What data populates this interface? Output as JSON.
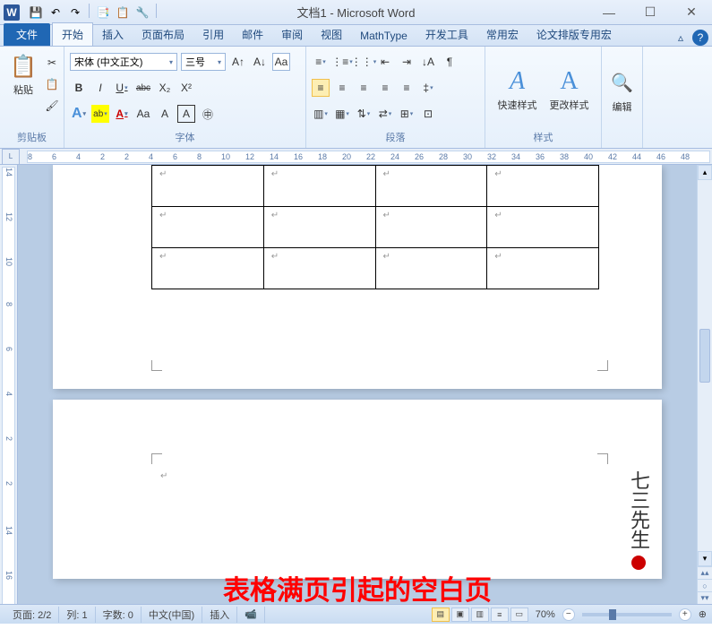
{
  "titlebar": {
    "app_icon": "W",
    "title": "文档1 - Microsoft Word"
  },
  "qat": [
    "💾",
    "↶",
    "↷",
    "📑",
    "📋",
    "🔧"
  ],
  "win": {
    "min": "—",
    "max": "☐",
    "close": "✕"
  },
  "tabs": {
    "file": "文件",
    "items": [
      "开始",
      "插入",
      "页面布局",
      "引用",
      "邮件",
      "审阅",
      "视图",
      "MathType",
      "开发工具",
      "常用宏",
      "论文排版专用宏"
    ],
    "active": 0,
    "minimize": "▵",
    "help": "?"
  },
  "ribbon": {
    "clipboard": {
      "label": "剪贴板",
      "paste": "粘贴",
      "cut": "✂",
      "copy": "📋",
      "painter": "🖌"
    },
    "font": {
      "label": "字体",
      "family": "宋体 (中文正文)",
      "size": "三号",
      "grow": "A↑",
      "shrink": "A↓",
      "clear": "Aa",
      "bold": "B",
      "italic": "I",
      "underline": "U",
      "strike": "abc",
      "sub": "X₂",
      "sup": "X²",
      "effects": "A",
      "highlight": "ab",
      "fontcolor": "A",
      "phonetic": "Aa",
      "change": "A",
      "border": "A",
      "enclose": "㊥"
    },
    "paragraph": {
      "label": "段落",
      "bullets": "≡",
      "numbers": "⋮≡",
      "multilevel": "⋮⋮",
      "dedent": "⇤",
      "indent": "⇥",
      "sort": "↓A",
      "show": "¶",
      "alignL": "≡",
      "alignC": "≡",
      "alignR": "≡",
      "justify": "≡",
      "distribute": "≡",
      "spacing": "‡",
      "shading": "▥",
      "borders": "▦",
      "vert": "⇅",
      "horiz": "⇄",
      "snap": "⊞",
      "grid": "⊡"
    },
    "styles": {
      "label": "样式",
      "quick": "快速样式",
      "change": "更改样式",
      "quickIcon": "A",
      "changeIcon": "A"
    },
    "editing": {
      "label": "编辑"
    }
  },
  "ruler": {
    "corner": "L",
    "hNums": [
      "8",
      "6",
      "4",
      "2",
      "2",
      "4",
      "6",
      "8",
      "10",
      "12",
      "14",
      "16",
      "18",
      "20",
      "22",
      "24",
      "26",
      "28",
      "30",
      "32",
      "34",
      "36",
      "38",
      "40",
      "42",
      "44",
      "46",
      "48"
    ],
    "vNums": [
      "14",
      "12",
      "10",
      "8",
      "6",
      "4",
      "2",
      "2",
      "14",
      "16"
    ]
  },
  "annotation": "表格满页引起的空白页",
  "watermark": "七三先生",
  "statusbar": {
    "page": "页面: 2/2",
    "col": "列: 1",
    "words": "字数: 0",
    "lang": "中文(中国)",
    "mode": "插入",
    "macro": "📹",
    "zoom": "70%",
    "minus": "−",
    "plus": "+",
    "expand": "⊕"
  }
}
